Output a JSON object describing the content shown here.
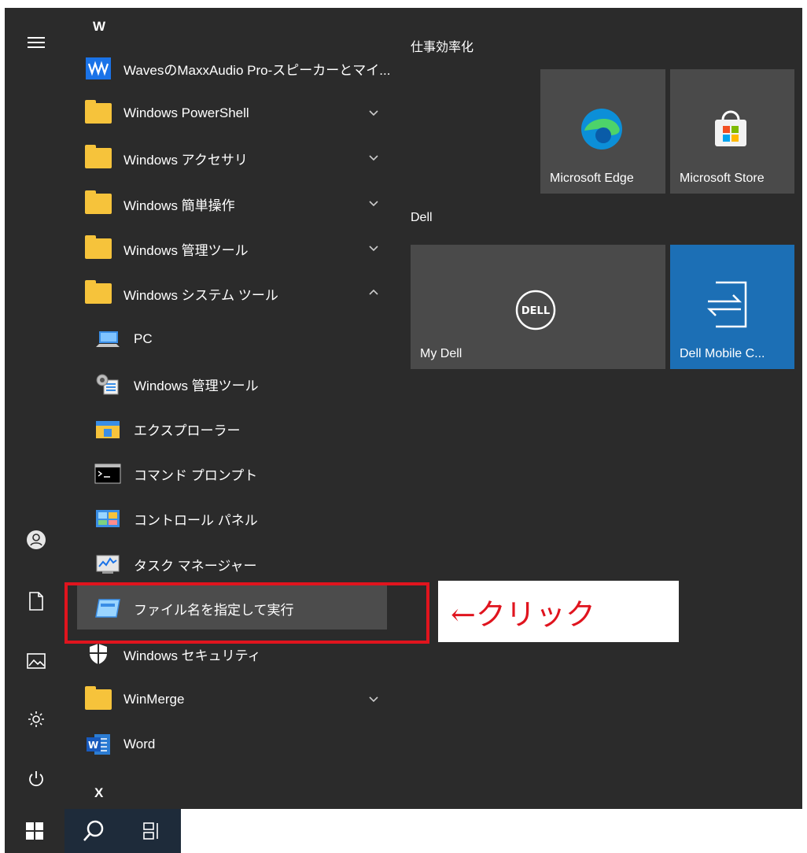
{
  "letters": {
    "w": "W",
    "x": "X"
  },
  "apps": [
    {
      "label": "WavesのMaxxAudio Pro-スピーカーとマイ...",
      "icon": "waves-maxxaudio-icon"
    },
    {
      "label": "Windows PowerShell",
      "icon": "folder-icon",
      "expandable": "collapsed"
    },
    {
      "label": "Windows アクセサリ",
      "icon": "folder-icon",
      "expandable": "collapsed"
    },
    {
      "label": "Windows 簡単操作",
      "icon": "folder-icon",
      "expandable": "collapsed"
    },
    {
      "label": "Windows 管理ツール",
      "icon": "folder-icon",
      "expandable": "collapsed"
    },
    {
      "label": "Windows システム ツール",
      "icon": "folder-icon",
      "expandable": "expanded"
    }
  ],
  "system_tools": [
    {
      "label": "PC",
      "icon": "pc-icon"
    },
    {
      "label": "Windows 管理ツール",
      "icon": "admin-tools-icon"
    },
    {
      "label": "エクスプローラー",
      "icon": "file-explorer-icon"
    },
    {
      "label": "コマンド プロンプト",
      "icon": "command-prompt-icon"
    },
    {
      "label": "コントロール パネル",
      "icon": "control-panel-icon"
    },
    {
      "label": "タスク マネージャー",
      "icon": "task-manager-icon"
    },
    {
      "label": "ファイル名を指定して実行",
      "icon": "run-icon",
      "highlighted": true
    }
  ],
  "apps_after": [
    {
      "label": "Windows セキュリティ",
      "icon": "windows-security-icon"
    },
    {
      "label": "WinMerge",
      "icon": "folder-icon",
      "expandable": "collapsed"
    },
    {
      "label": "Word",
      "icon": "word-icon"
    }
  ],
  "tile_groups": [
    {
      "title": "仕事効率化",
      "tiles": [
        {
          "label": "Microsoft Edge",
          "icon": "edge-icon"
        },
        {
          "label": "Microsoft Store",
          "icon": "store-icon"
        }
      ]
    },
    {
      "title": "Dell",
      "tiles": [
        {
          "label": "My Dell",
          "icon": "dell-logo-icon"
        },
        {
          "label": "Dell Mobile C...",
          "icon": "dell-mobile-connect-icon"
        }
      ]
    }
  ],
  "annotation": {
    "callout_text": "←クリック"
  },
  "colors": {
    "menu_bg": "#2b2b2b",
    "tile_bg": "#4a4a4a",
    "tile_accent": "#1c6fb5",
    "folder": "#f6c33b",
    "annotation_red": "#e0141e"
  }
}
